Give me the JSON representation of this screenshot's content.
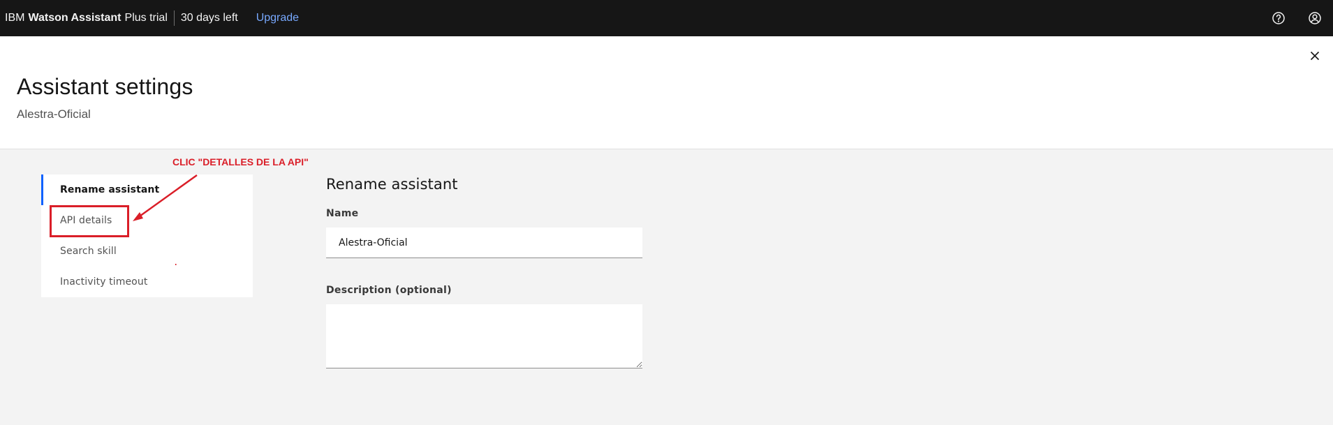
{
  "topbar": {
    "brand_prefix": "IBM",
    "brand_product": "Watson Assistant",
    "brand_plan": "Plus trial",
    "trial_status": "30 days left",
    "upgrade_label": "Upgrade",
    "icons": [
      "help-icon",
      "user-avatar-icon"
    ]
  },
  "header": {
    "title": "Assistant settings",
    "subtitle": "Alestra-Oficial",
    "close_icon": "close-icon"
  },
  "sidenav": {
    "items": [
      {
        "label": "Rename assistant",
        "active": true
      },
      {
        "label": "API details",
        "active": false
      },
      {
        "label": "Search skill",
        "active": false
      },
      {
        "label": "Inactivity timeout",
        "active": false
      }
    ]
  },
  "annotation": {
    "text": "CLIC \"DETALLES DE LA API\"",
    "color": "#da1e28"
  },
  "form": {
    "title": "Rename assistant",
    "name_label": "Name",
    "name_value": "Alestra-Oficial",
    "description_label": "Description (optional)",
    "description_value": ""
  },
  "colors": {
    "topbar_bg": "#161616",
    "accent": "#0f62fe",
    "link": "#78a9ff",
    "annotation": "#da1e28"
  }
}
